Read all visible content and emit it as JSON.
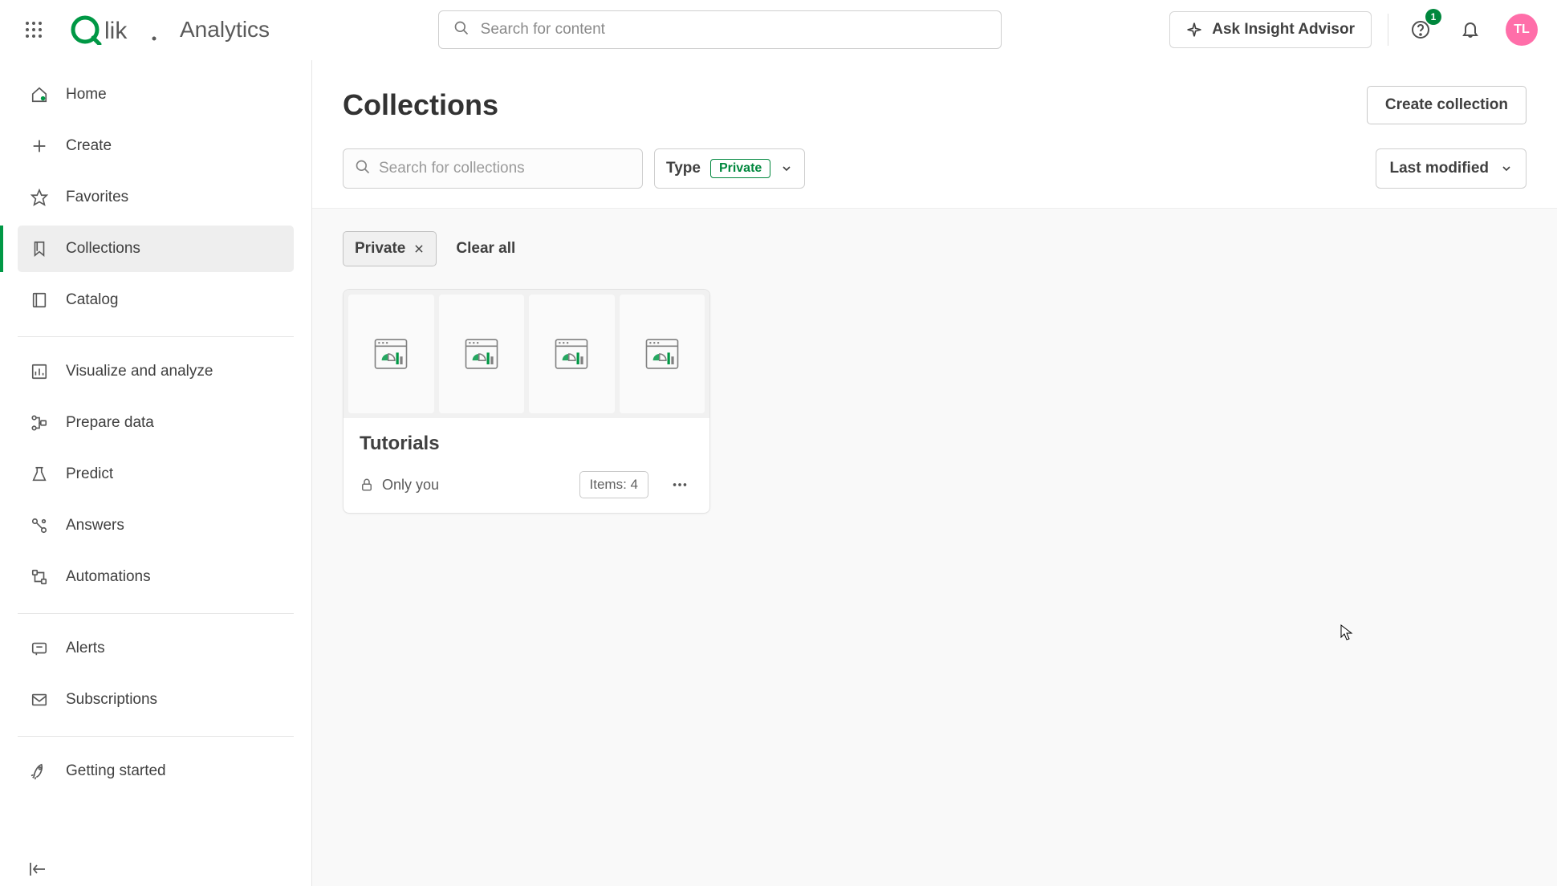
{
  "header": {
    "app_label": "Analytics",
    "search_placeholder": "Search for content",
    "insight_label": "Ask Insight Advisor",
    "notification_count": "1",
    "avatar_initials": "TL"
  },
  "sidebar": {
    "items": [
      {
        "label": "Home",
        "icon": "home-icon"
      },
      {
        "label": "Create",
        "icon": "plus-icon"
      },
      {
        "label": "Favorites",
        "icon": "star-icon"
      },
      {
        "label": "Collections",
        "icon": "bookmark-icon",
        "active": true
      },
      {
        "label": "Catalog",
        "icon": "catalog-icon"
      }
    ],
    "items2": [
      {
        "label": "Visualize and analyze",
        "icon": "chart-icon"
      },
      {
        "label": "Prepare data",
        "icon": "flow-icon"
      },
      {
        "label": "Predict",
        "icon": "flask-icon"
      },
      {
        "label": "Answers",
        "icon": "answers-icon"
      },
      {
        "label": "Automations",
        "icon": "automation-icon"
      }
    ],
    "items3": [
      {
        "label": "Alerts",
        "icon": "alert-icon"
      },
      {
        "label": "Subscriptions",
        "icon": "mail-icon"
      }
    ],
    "items4": [
      {
        "label": "Getting started",
        "icon": "rocket-icon"
      }
    ]
  },
  "page": {
    "title": "Collections",
    "create_label": "Create collection",
    "search_placeholder": "Search for collections",
    "type_label": "Type",
    "type_value": "Private",
    "sort_label": "Last modified",
    "filter_chip": "Private",
    "clear_all": "Clear all"
  },
  "card": {
    "title": "Tutorials",
    "visibility": "Only you",
    "items_label": "Items: 4"
  }
}
